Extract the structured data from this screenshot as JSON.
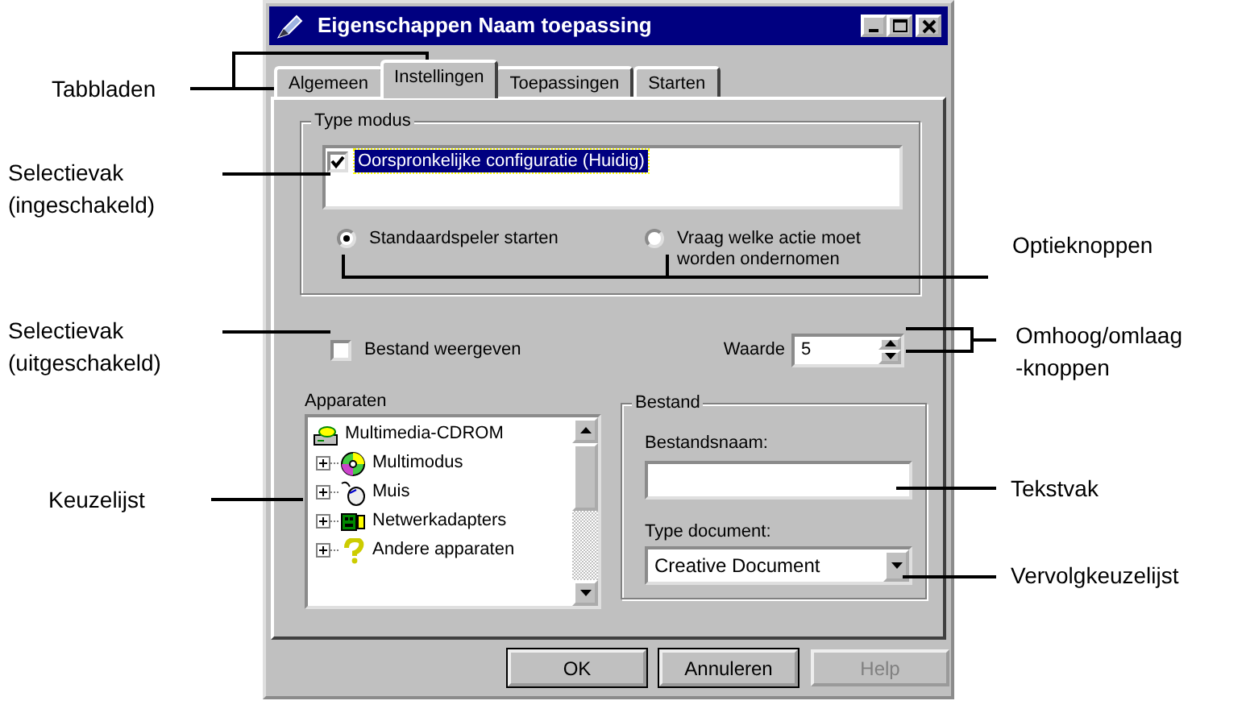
{
  "window": {
    "title": "Eigenschappen Naam toepassing"
  },
  "tabs": [
    {
      "label": "Algemeen",
      "selected": false
    },
    {
      "label": "Instellingen",
      "selected": true
    },
    {
      "label": "Toepassingen",
      "selected": false
    },
    {
      "label": "Starten",
      "selected": false
    }
  ],
  "type_mode": {
    "title": "Type modus",
    "items": [
      {
        "label": "Oorspronkelijke configuratie (Huidig)",
        "checked": true,
        "selected": true
      }
    ],
    "radios": [
      {
        "label": "Standaardspeler starten",
        "selected": true
      },
      {
        "label": "Vraag welke actie moet worden ondernomen",
        "selected": false
      }
    ]
  },
  "show_file": {
    "label": "Bestand weergeven",
    "checked": false
  },
  "value_field": {
    "label": "Waarde",
    "value": "5"
  },
  "devices": {
    "label": "Apparaten",
    "tree": [
      {
        "label": "Multimedia-CDROM",
        "kind": "cdrom",
        "children": [
          {
            "label": "Multimodus",
            "kind": "disc",
            "expanded": false
          },
          {
            "label": "Muis",
            "kind": "mouse",
            "expanded": false
          },
          {
            "label": "Netwerkadapters",
            "kind": "network",
            "expanded": false
          },
          {
            "label": "Andere apparaten",
            "kind": "unknown",
            "expanded": false
          }
        ]
      }
    ]
  },
  "file_group": {
    "title": "Bestand",
    "name_label": "Bestandsnaam:",
    "type_label": "Type document:",
    "type_value": "Creative Document"
  },
  "buttons": [
    {
      "label": "OK",
      "disabled": false
    },
    {
      "label": "Annuleren",
      "disabled": false
    },
    {
      "label": "Help",
      "disabled": true
    }
  ],
  "callouts": [
    {
      "label": "Tabbladen"
    },
    {
      "label": "Selectievak\n(ingeschakeld)"
    },
    {
      "label": "Selectievak\n(uitgeschakeld)"
    },
    {
      "label": "Keuzelijst"
    },
    {
      "label": "Optieknoppen"
    },
    {
      "label": "Omhoog/omlaag\n-knoppen"
    },
    {
      "label": "Tekstvak"
    },
    {
      "label": "Vervolgkeuzelijst"
    }
  ]
}
